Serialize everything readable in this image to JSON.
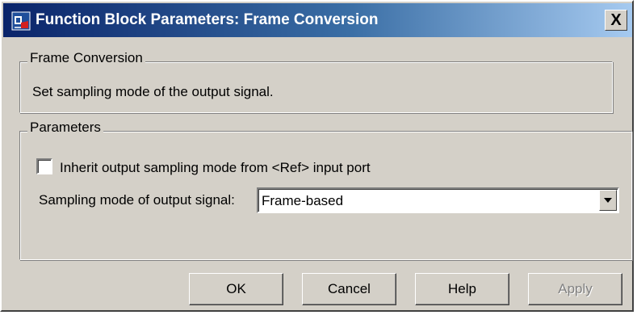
{
  "window": {
    "title": "Function Block Parameters: Frame Conversion",
    "close_label": "X"
  },
  "block_group": {
    "legend": "Frame Conversion",
    "description": "Set sampling mode of the output signal."
  },
  "params_group": {
    "legend": "Parameters",
    "inherit_checkbox": {
      "label": "Inherit output sampling mode from <Ref> input port",
      "checked": false
    },
    "sampling_mode": {
      "label": "Sampling mode of output signal:",
      "value": "Frame-based"
    }
  },
  "buttons": {
    "ok": "OK",
    "cancel": "Cancel",
    "help": "Help",
    "apply": "Apply"
  },
  "colors": {
    "face": "#d4d0c8",
    "title_start": "#0a246a",
    "title_end": "#a6caf0"
  },
  "icons": [
    "simulink-block-icon",
    "close-icon",
    "dropdown-arrow-icon"
  ]
}
